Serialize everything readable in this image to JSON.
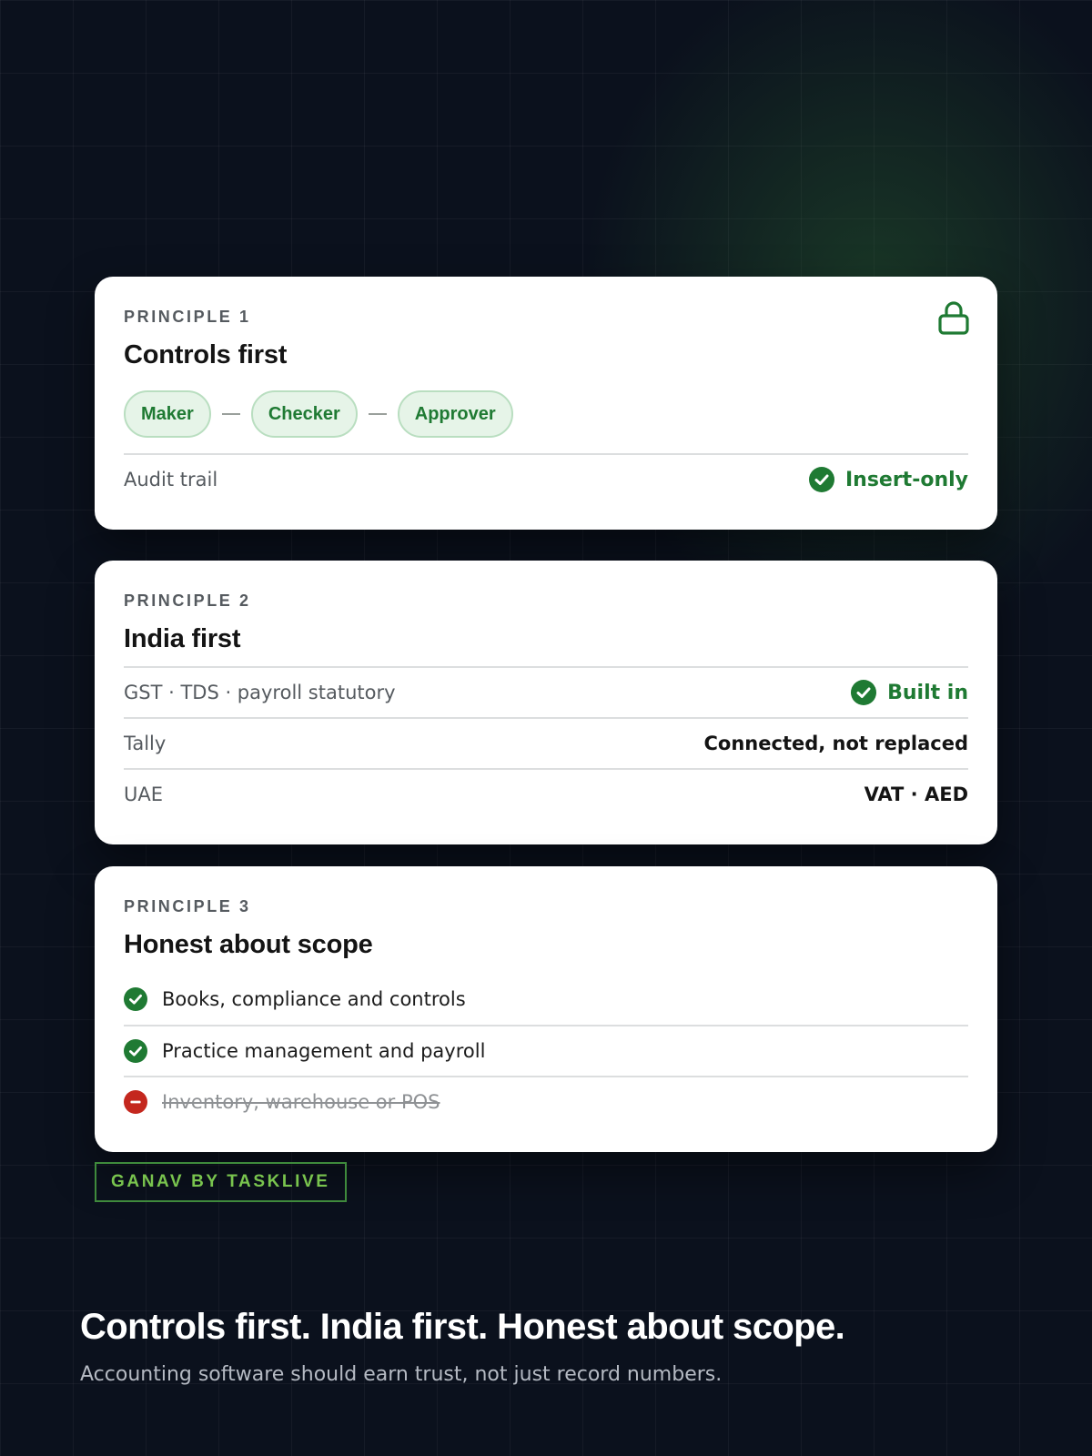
{
  "colors": {
    "background": "#0b111d",
    "card": "#ffffff",
    "accent_green": "#1f7a33",
    "chip_bg": "#e6f4e8",
    "brand_green": "#79c44e",
    "error_red": "#c4271e"
  },
  "principle1": {
    "eyebrow": "PRINCIPLE 1",
    "title": "Controls first",
    "icon": "lock-icon",
    "chips": [
      {
        "label": "Maker"
      },
      {
        "label": "Checker"
      },
      {
        "label": "Approver"
      }
    ],
    "row": {
      "label": "Audit trail",
      "value": "Insert-only",
      "icon": "check-circle-icon"
    }
  },
  "principle2": {
    "eyebrow": "PRINCIPLE 2",
    "title": "India first",
    "rows": [
      {
        "label": "GST · TDS · payroll statutory",
        "value": "Built in",
        "icon": "check-circle-icon"
      },
      {
        "label": "Tally",
        "value": "Connected, not replaced"
      },
      {
        "label": "UAE",
        "value": "VAT · AED"
      }
    ]
  },
  "principle3": {
    "eyebrow": "PRINCIPLE 3",
    "title": "Honest about scope",
    "items": [
      {
        "label": "Books, compliance and controls",
        "status": "included",
        "icon": "check-circle-icon"
      },
      {
        "label": "Practice management and payroll",
        "status": "included",
        "icon": "check-circle-icon"
      },
      {
        "label": "Inventory, warehouse or POS",
        "status": "excluded",
        "icon": "minus-circle-icon"
      }
    ]
  },
  "brand": {
    "label": "GANAV BY TASKLIVE"
  },
  "hero": {
    "headline": "Controls first. India first. Honest about scope.",
    "subline": "Accounting software should earn trust, not just record numbers."
  }
}
